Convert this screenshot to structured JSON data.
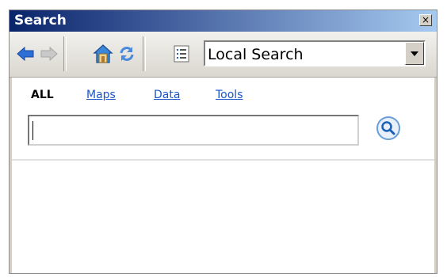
{
  "window": {
    "title": "Search",
    "close_label": "×"
  },
  "toolbar": {
    "buttons": [
      {
        "name": "back-button",
        "icon": "back-arrow-icon"
      },
      {
        "name": "forward-button",
        "icon": "forward-arrow-icon"
      },
      {
        "name": "home-button",
        "icon": "home-icon"
      },
      {
        "name": "refresh-button",
        "icon": "refresh-icon"
      },
      {
        "name": "options-button",
        "icon": "list-options-icon"
      }
    ],
    "search_source": {
      "selected": "Local Search"
    }
  },
  "tabs": [
    {
      "label": "ALL",
      "active": true
    },
    {
      "label": "Maps",
      "active": false
    },
    {
      "label": "Data",
      "active": false
    },
    {
      "label": "Tools",
      "active": false
    }
  ],
  "search": {
    "value": "",
    "button_icon": "magnifier-icon"
  },
  "colors": {
    "title_start": "#0a246a",
    "title_end": "#a6caf0",
    "link": "#1b57c9"
  }
}
